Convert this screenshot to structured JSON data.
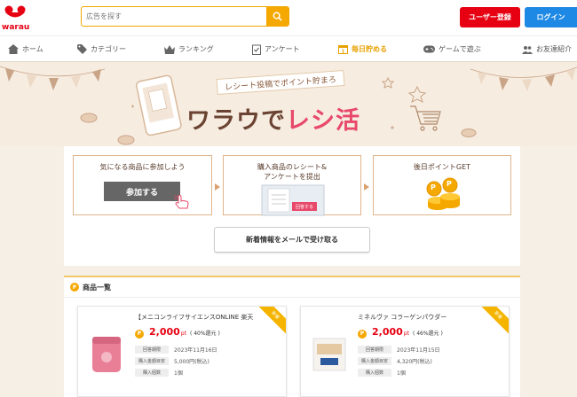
{
  "header": {
    "logo_text": "warau",
    "search_placeholder": "広告を探す",
    "register_label": "ユーザー登録",
    "login_label": "ログイン"
  },
  "nav": {
    "items": [
      {
        "label": "ホーム",
        "icon": "home-icon"
      },
      {
        "label": "カテゴリー",
        "icon": "tag-icon"
      },
      {
        "label": "ランキング",
        "icon": "crown-icon"
      },
      {
        "label": "アンケート",
        "icon": "survey-icon"
      },
      {
        "label": "毎日貯める",
        "icon": "calendar-icon",
        "active": true
      },
      {
        "label": "ゲームで遊ぶ",
        "icon": "gamepad-icon"
      },
      {
        "label": "お友達紹介",
        "icon": "friends-icon"
      }
    ]
  },
  "banner": {
    "subtitle": "レシート投稿でポイント貯まろ",
    "title_main": "ワラウで",
    "title_accent": "レシ活"
  },
  "steps": {
    "step1": "気になる商品に参加しよう",
    "join_label": "参加する",
    "step2_line1": "購入商品のレシート&",
    "step2_line2": "アンケートを提出",
    "step2_tag": "回答する",
    "step3": "後日ポイントGET",
    "coin_mark": "P",
    "mail_label": "新着情報をメールで受け取る"
  },
  "product_list": {
    "heading": "商品一覧",
    "coin_mark": "P",
    "badge": "新着",
    "labels": {
      "period": "回答期限",
      "price": "購入金額目安",
      "count": "購入個数"
    },
    "items": [
      {
        "title": "【メニコンライフサイエンスONLINE 楽天",
        "points": "2,000",
        "unit": "pt",
        "rate": "( 40%還元 )",
        "period": "2023年11月16日",
        "price": "5,000円(税込)",
        "count": "1個"
      },
      {
        "title": "ミネルヴァ コラーゲンパウダー",
        "points": "2,000",
        "unit": "pt",
        "rate": "( 46%還元 )",
        "period": "2023年11月15日",
        "price": "4,320円(税込)",
        "count": "1個"
      }
    ]
  },
  "colors": {
    "brand_red": "#e60012",
    "accent_orange": "#f5a800",
    "login_blue": "#1e88e5",
    "banner_bg": "#f6ece0",
    "title_brown": "#6b4332",
    "title_pink": "#e8486a"
  }
}
